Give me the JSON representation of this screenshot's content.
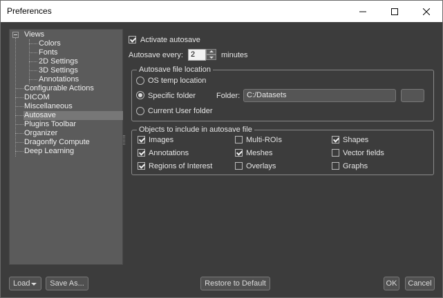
{
  "window": {
    "title": "Preferences"
  },
  "tree": {
    "items": [
      {
        "label": "Views",
        "level": 0,
        "expanded": true,
        "selected": false
      },
      {
        "label": "Colors",
        "level": 1,
        "selected": false
      },
      {
        "label": "Fonts",
        "level": 1,
        "selected": false
      },
      {
        "label": "2D Settings",
        "level": 1,
        "selected": false
      },
      {
        "label": "3D Settings",
        "level": 1,
        "selected": false
      },
      {
        "label": "Annotations",
        "level": 1,
        "selected": false
      },
      {
        "label": "Configurable Actions",
        "level": 0,
        "selected": false
      },
      {
        "label": "DICOM",
        "level": 0,
        "selected": false
      },
      {
        "label": "Miscellaneous",
        "level": 0,
        "selected": false
      },
      {
        "label": "Autosave",
        "level": 0,
        "selected": true
      },
      {
        "label": "Plugins Toolbar",
        "level": 0,
        "selected": false
      },
      {
        "label": "Organizer",
        "level": 0,
        "selected": false
      },
      {
        "label": "Dragonfly Compute",
        "level": 0,
        "selected": false
      },
      {
        "label": "Deep Learning",
        "level": 0,
        "selected": false
      }
    ]
  },
  "autosave": {
    "activate_label": "Activate autosave",
    "activate_checked": true,
    "every_label": "Autosave every:",
    "every_value": "2",
    "every_unit": "minutes"
  },
  "location": {
    "group_title": "Autosave file location",
    "options": [
      {
        "label": "OS temp location",
        "checked": false
      },
      {
        "label": "Specific folder",
        "checked": true
      },
      {
        "label": "Current User folder",
        "checked": false
      }
    ],
    "folder_label": "Folder:",
    "folder_value": "C:/Datasets"
  },
  "objects": {
    "group_title": "Objects to include in autosave file",
    "items": [
      {
        "label": "Images",
        "checked": true
      },
      {
        "label": "Multi-ROIs",
        "checked": false
      },
      {
        "label": "Shapes",
        "checked": true
      },
      {
        "label": "Annotations",
        "checked": true
      },
      {
        "label": "Meshes",
        "checked": true
      },
      {
        "label": "Vector fields",
        "checked": false
      },
      {
        "label": "Regions of Interest",
        "checked": true
      },
      {
        "label": "Overlays",
        "checked": false
      },
      {
        "label": "Graphs",
        "checked": false
      }
    ]
  },
  "footer": {
    "load_label": "Load",
    "save_as_label": "Save As...",
    "restore_label": "Restore to Default",
    "ok_label": "OK",
    "cancel_label": "Cancel"
  },
  "icons": {
    "minimize": "minimize-icon",
    "maximize": "maximize-icon",
    "close": "close-icon",
    "expander": "tree-collapse-icon",
    "dropdown": "chevron-down-icon"
  }
}
